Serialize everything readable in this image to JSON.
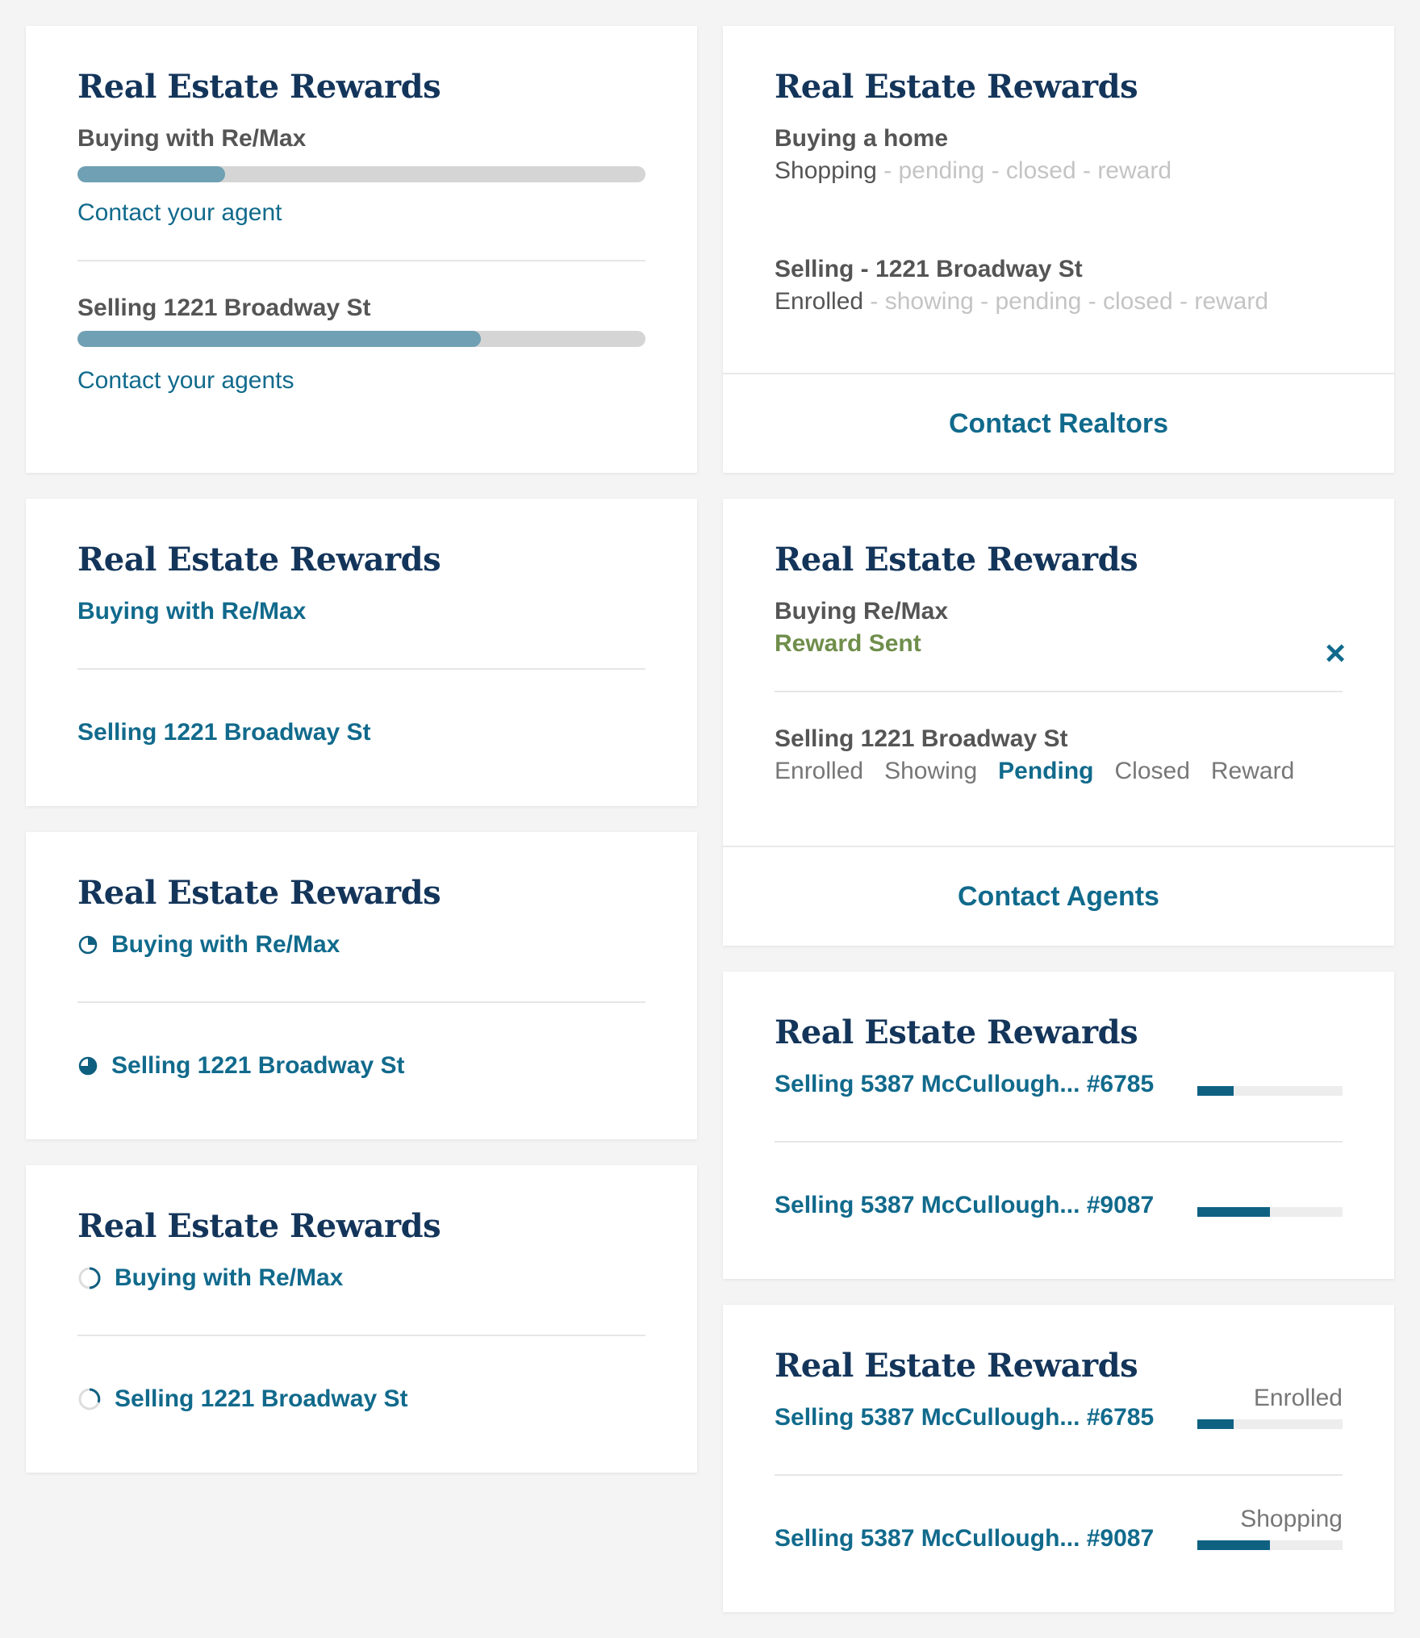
{
  "card_title": "Real Estate Rewards",
  "card1": {
    "buy_label": "Buying with Re/Max",
    "buy_progress": 0.26,
    "buy_link": "Contact your agent",
    "sell_label": "Selling 1221 Broadway St",
    "sell_progress": 0.71,
    "sell_link": "Contact your agents"
  },
  "card2": {
    "buy_label": "Buying a home",
    "buy_steps": [
      "Shopping",
      "pending",
      "closed",
      "reward"
    ],
    "sell_label": "Selling - 1221 Broadway St",
    "sell_steps": [
      "Enrolled",
      "showing",
      "pending",
      "closed",
      "reward"
    ],
    "step_separator": " - ",
    "footer": "Contact Realtors"
  },
  "card3": {
    "buy_label": "Buying with Re/Max",
    "sell_label": "Selling 1221 Broadway St"
  },
  "card4": {
    "buy_label": "Buying Re/Max",
    "buy_status": "Reward Sent",
    "close_icon": "×",
    "sell_label": "Selling 1221 Broadway St",
    "tabs": [
      "Enrolled",
      "Showing",
      "Pending",
      "Closed",
      "Reward"
    ],
    "active_tab": "Pending",
    "footer": "Contact Agents"
  },
  "card5": {
    "buy_label": "Buying with Re/Max",
    "buy_icon": "pie-quarter-icon",
    "sell_label": "Selling 1221 Broadway St",
    "sell_icon": "pie-three-quarter-icon"
  },
  "card6": {
    "rows": [
      {
        "label": "Selling 5387 McCullough... #6785",
        "progress": 0.25
      },
      {
        "label": "Selling 5387 McCullough...  #9087",
        "progress": 0.5
      }
    ]
  },
  "card7": {
    "buy_label": "Buying with Re/Max",
    "buy_icon": "ring-progress-icon",
    "sell_label": "Selling 1221 Broadway St",
    "sell_icon": "ring-progress-icon"
  },
  "card8": {
    "rows": [
      {
        "label": "Selling 5387 McCullough... #6785",
        "progress": 0.25,
        "status": "Enrolled"
      },
      {
        "label": "Selling 5387 McCullough...  #9087",
        "progress": 0.5,
        "status": "Shopping"
      }
    ]
  },
  "colors": {
    "title": "#14355a",
    "link": "#116a8c",
    "bar_fill": "#6fa0b3",
    "bar_track": "#d5d5d5",
    "green": "#6f8e4b"
  }
}
